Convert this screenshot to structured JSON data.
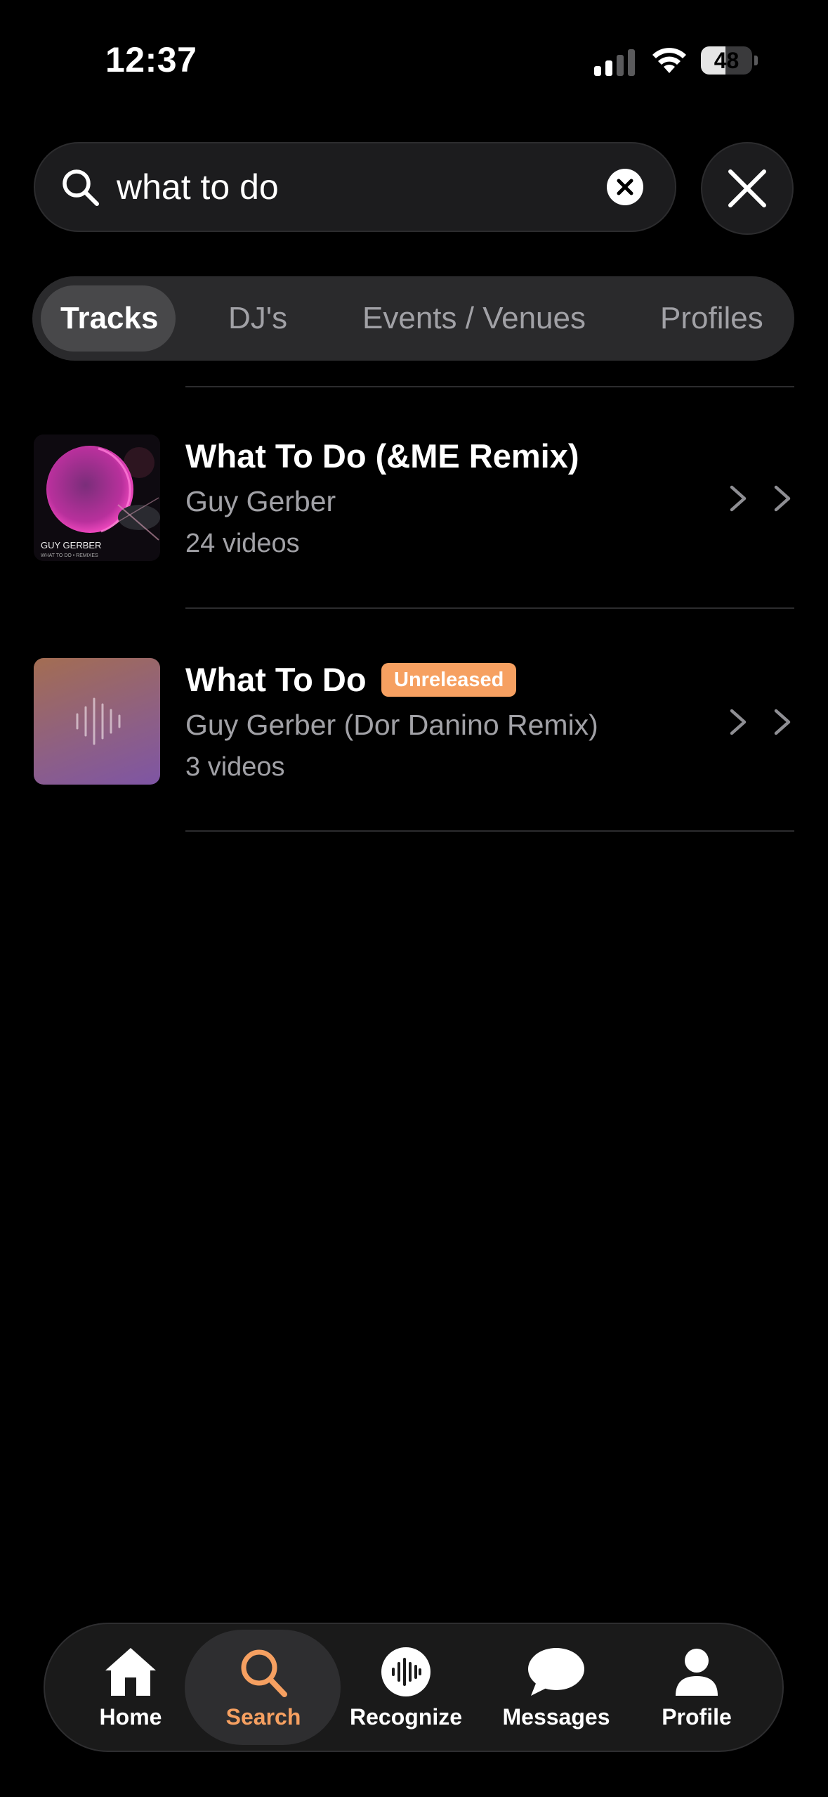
{
  "status_bar": {
    "time": "12:37",
    "battery_percent": "48",
    "battery_level": 0.48
  },
  "search": {
    "query": "what to do",
    "icons": [
      "search-icon",
      "clear-icon",
      "close-icon"
    ]
  },
  "tabs": [
    {
      "label": "Tracks",
      "active": true
    },
    {
      "label": "DJ's",
      "active": false
    },
    {
      "label": "Events / Venues",
      "active": false
    },
    {
      "label": "Profiles",
      "active": false
    }
  ],
  "results": [
    {
      "title": "What To Do (&ME Remix)",
      "artist": "Guy Gerber",
      "count": "24 videos",
      "art_caption": "GUY GERBER",
      "art_subcaption": "WHAT TO DO • REMIXES"
    },
    {
      "title": "What To Do",
      "badge": "Unreleased",
      "artist": "Guy Gerber (Dor Danino Remix)",
      "count": "3 videos"
    }
  ],
  "nav": [
    {
      "label": "Home",
      "icon": "home-icon",
      "active": false
    },
    {
      "label": "Search",
      "icon": "search-icon",
      "active": true
    },
    {
      "label": "Recognize",
      "icon": "waveform-icon",
      "active": false
    },
    {
      "label": "Messages",
      "icon": "chat-bubble-icon",
      "active": false
    },
    {
      "label": "Profile",
      "icon": "person-icon",
      "active": false
    }
  ],
  "colors": {
    "accent": "#f6a061",
    "background": "#000000",
    "surface": "#1c1c1e"
  }
}
